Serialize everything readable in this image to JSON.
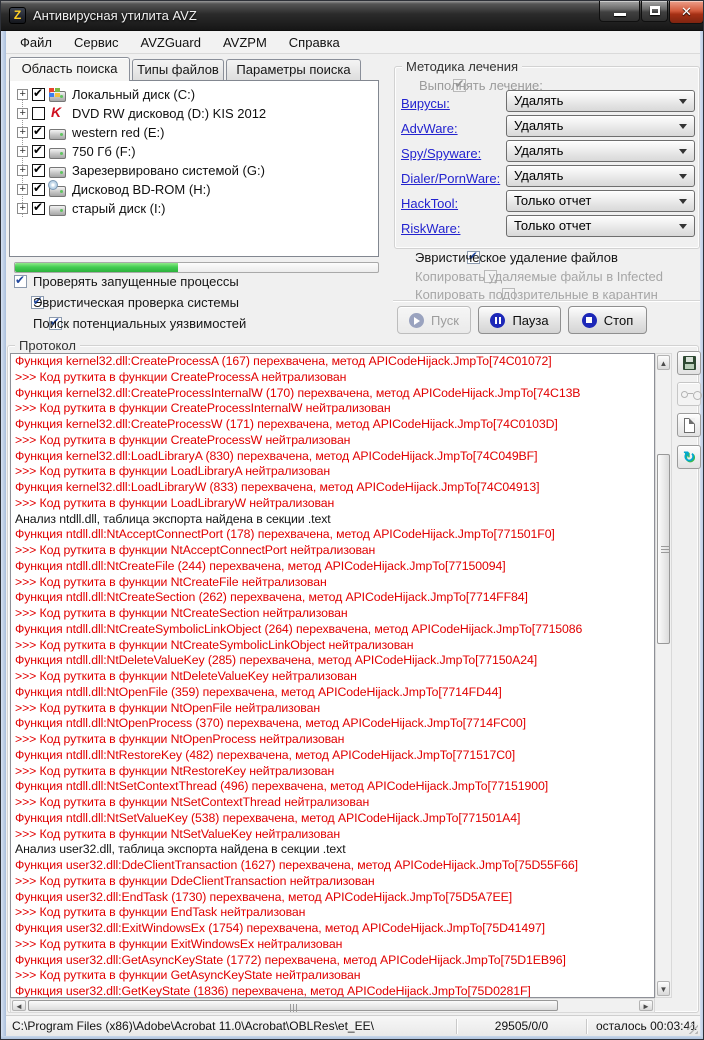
{
  "window": {
    "title": "Антивирусная утилита AVZ"
  },
  "menu": {
    "items": [
      {
        "label": "Файл"
      },
      {
        "label": "Сервис"
      },
      {
        "label": "AVZGuard"
      },
      {
        "label": "AVZPM"
      },
      {
        "label": "Справка"
      }
    ]
  },
  "tabs": [
    {
      "label": "Область поиска",
      "active": true
    },
    {
      "label": "Типы файлов",
      "active": false
    },
    {
      "label": "Параметры поиска",
      "active": false
    }
  ],
  "tree": {
    "items": [
      {
        "label": "Локальный диск (C:)",
        "checked": true,
        "icon": "windows-drive-icon"
      },
      {
        "label": "DVD RW дисковод (D:) KIS 2012",
        "checked": false,
        "icon": "kaspersky-disc-icon"
      },
      {
        "label": "western red (E:)",
        "checked": true,
        "icon": "hard-drive-icon"
      },
      {
        "label": "750 Гб (F:)",
        "checked": true,
        "icon": "hard-drive-icon"
      },
      {
        "label": "Зарезервировано системой (G:)",
        "checked": true,
        "icon": "hard-drive-icon"
      },
      {
        "label": "Дисковод BD-ROM (H:)",
        "checked": true,
        "icon": "bdrom-drive-icon"
      },
      {
        "label": "старый диск (I:)",
        "checked": true,
        "icon": "hard-drive-icon"
      }
    ]
  },
  "progress": {
    "percent": 45
  },
  "scan_options": [
    {
      "label": "Проверять запущенные процессы",
      "checked": true
    },
    {
      "label": "Эвристическая проверка системы",
      "checked": true
    },
    {
      "label": "Поиск потенциальных уязвимостей",
      "checked": true
    }
  ],
  "treatment": {
    "title": "Методика лечения",
    "master": {
      "label": "Выполнять лечение:",
      "checked": true,
      "disabled": true
    },
    "rows": [
      {
        "link": "Вирусы:",
        "action": "Удалять"
      },
      {
        "link": "AdvWare:",
        "action": "Удалять"
      },
      {
        "link": "Spy/Spyware:",
        "action": "Удалять"
      },
      {
        "link": "Dialer/PornWare:",
        "action": "Удалять"
      },
      {
        "link": "HackTool:",
        "action": "Только отчет"
      },
      {
        "link": "RiskWare:",
        "action": "Только отчет"
      }
    ],
    "options": [
      {
        "label": "Эвристическое удаление файлов",
        "checked": true,
        "disabled": false
      },
      {
        "label": "Копировать удаляемые файлы в  Infected",
        "checked": false,
        "disabled": true
      },
      {
        "label": "Копировать подозрительные в  карантин",
        "checked": false,
        "disabled": true
      }
    ],
    "buttons": [
      {
        "label": "Пуск",
        "icon": "play-icon",
        "disabled": true
      },
      {
        "label": "Пауза",
        "icon": "pause-icon",
        "disabled": false
      },
      {
        "label": "Стоп",
        "icon": "stop-icon",
        "disabled": false
      }
    ]
  },
  "protocol": {
    "title": "Протокол",
    "side_buttons": [
      {
        "icon": "save-icon",
        "disabled": false
      },
      {
        "icon": "glasses-icon",
        "disabled": true
      },
      {
        "icon": "new-document-icon",
        "disabled": false
      },
      {
        "icon": "script-icon",
        "disabled": false
      }
    ],
    "lines": [
      {
        "color": "red",
        "text": "Функция kernel32.dll:CreateProcessA (167) перехвачена, метод APICodeHijack.JmpTo[74C01072]"
      },
      {
        "color": "red",
        "text": ">>> Код руткита в функции CreateProcessA нейтрализован"
      },
      {
        "color": "red",
        "text": "Функция kernel32.dll:CreateProcessInternalW (170) перехвачена, метод APICodeHijack.JmpTo[74C13B"
      },
      {
        "color": "red",
        "text": ">>> Код руткита в функции CreateProcessInternalW нейтрализован"
      },
      {
        "color": "red",
        "text": "Функция kernel32.dll:CreateProcessW (171) перехвачена, метод APICodeHijack.JmpTo[74C0103D]"
      },
      {
        "color": "red",
        "text": ">>> Код руткита в функции CreateProcessW нейтрализован"
      },
      {
        "color": "red",
        "text": "Функция kernel32.dll:LoadLibraryA (830) перехвачена, метод APICodeHijack.JmpTo[74C049BF]"
      },
      {
        "color": "red",
        "text": ">>> Код руткита в функции LoadLibraryA нейтрализован"
      },
      {
        "color": "red",
        "text": "Функция kernel32.dll:LoadLibraryW (833) перехвачена, метод APICodeHijack.JmpTo[74C04913]"
      },
      {
        "color": "red",
        "text": ">>> Код руткита в функции LoadLibraryW нейтрализован"
      },
      {
        "color": "black",
        "text": "Анализ ntdll.dll, таблица экспорта найдена в секции .text"
      },
      {
        "color": "red",
        "text": "Функция ntdll.dll:NtAcceptConnectPort (178) перехвачена, метод APICodeHijack.JmpTo[771501F0]"
      },
      {
        "color": "red",
        "text": ">>> Код руткита в функции NtAcceptConnectPort нейтрализован"
      },
      {
        "color": "red",
        "text": "Функция ntdll.dll:NtCreateFile (244) перехвачена, метод APICodeHijack.JmpTo[77150094]"
      },
      {
        "color": "red",
        "text": ">>> Код руткита в функции NtCreateFile нейтрализован"
      },
      {
        "color": "red",
        "text": "Функция ntdll.dll:NtCreateSection (262) перехвачена, метод APICodeHijack.JmpTo[7714FF84]"
      },
      {
        "color": "red",
        "text": ">>> Код руткита в функции NtCreateSection нейтрализован"
      },
      {
        "color": "red",
        "text": "Функция ntdll.dll:NtCreateSymbolicLinkObject (264) перехвачена, метод APICodeHijack.JmpTo[7715086"
      },
      {
        "color": "red",
        "text": ">>> Код руткита в функции NtCreateSymbolicLinkObject нейтрализован"
      },
      {
        "color": "red",
        "text": "Функция ntdll.dll:NtDeleteValueKey (285) перехвачена, метод APICodeHijack.JmpTo[77150A24]"
      },
      {
        "color": "red",
        "text": ">>> Код руткита в функции NtDeleteValueKey нейтрализован"
      },
      {
        "color": "red",
        "text": "Функция ntdll.dll:NtOpenFile (359) перехвачена, метод APICodeHijack.JmpTo[7714FD44]"
      },
      {
        "color": "red",
        "text": ">>> Код руткита в функции NtOpenFile нейтрализован"
      },
      {
        "color": "red",
        "text": "Функция ntdll.dll:NtOpenProcess (370) перехвачена, метод APICodeHijack.JmpTo[7714FC00]"
      },
      {
        "color": "red",
        "text": ">>> Код руткита в функции NtOpenProcess нейтрализован"
      },
      {
        "color": "red",
        "text": "Функция ntdll.dll:NtRestoreKey (482) перехвачена, метод APICodeHijack.JmpTo[771517C0]"
      },
      {
        "color": "red",
        "text": ">>> Код руткита в функции NtRestoreKey нейтрализован"
      },
      {
        "color": "red",
        "text": "Функция ntdll.dll:NtSetContextThread (496) перехвачена, метод APICodeHijack.JmpTo[77151900]"
      },
      {
        "color": "red",
        "text": ">>> Код руткита в функции NtSetContextThread нейтрализован"
      },
      {
        "color": "red",
        "text": "Функция ntdll.dll:NtSetValueKey (538) перехвачена, метод APICodeHijack.JmpTo[771501A4]"
      },
      {
        "color": "red",
        "text": ">>> Код руткита в функции NtSetValueKey нейтрализован"
      },
      {
        "color": "black",
        "text": "Анализ user32.dll, таблица экспорта найдена в секции .text"
      },
      {
        "color": "red",
        "text": "Функция user32.dll:DdeClientTransaction (1627) перехвачена, метод APICodeHijack.JmpTo[75D55F66]"
      },
      {
        "color": "red",
        "text": ">>> Код руткита в функции DdeClientTransaction нейтрализован"
      },
      {
        "color": "red",
        "text": "Функция user32.dll:EndTask (1730) перехвачена, метод APICodeHijack.JmpTo[75D5A7EE]"
      },
      {
        "color": "red",
        "text": ">>> Код руткита в функции EndTask нейтрализован"
      },
      {
        "color": "red",
        "text": "Функция user32.dll:ExitWindowsEx (1754) перехвачена, метод APICodeHijack.JmpTo[75D41497]"
      },
      {
        "color": "red",
        "text": ">>> Код руткита в функции ExitWindowsEx нейтрализован"
      },
      {
        "color": "red",
        "text": "Функция user32.dll:GetAsyncKeyState (1772) перехвачена, метод APICodeHijack.JmpTo[75D1EB96]"
      },
      {
        "color": "red",
        "text": ">>> Код руткита в функции GetAsyncKeyState нейтрализован"
      },
      {
        "color": "red",
        "text": "Функция user32.dll:GetKeyState (1836) перехвачена, метод APICodeHijack.JmpTo[75D0281F]"
      }
    ]
  },
  "statusbar": {
    "path": "C:\\Program Files (x86)\\Adobe\\Acrobat 11.0\\Acrobat\\OBLRes\\et_EE\\",
    "counter": "29505/0/0",
    "remaining": "осталось 00:03:41"
  },
  "colors": {
    "log_red": "#e10000",
    "log_black": "#141414",
    "link_blue": "#2323cf",
    "progress_green": "#44cd52"
  }
}
